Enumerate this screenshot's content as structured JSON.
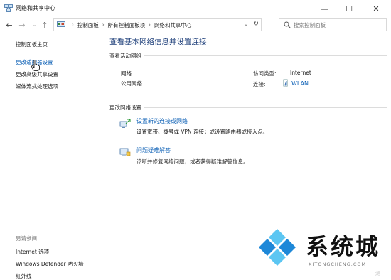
{
  "window": {
    "title": "网络和共享中心",
    "icon": "network-center-icon",
    "controls": {
      "minimize": "—",
      "maximize": "☐",
      "close": "✕"
    }
  },
  "nav": {
    "back": "←",
    "forward": "→",
    "dropdown": "⌄",
    "up": "↑"
  },
  "address": {
    "crumbs": [
      "控制面板",
      "所有控制面板项",
      "网络和共享中心"
    ],
    "separator": "›",
    "dropdown": "⌄",
    "refresh": "↻"
  },
  "search": {
    "placeholder": "搜索控制面板"
  },
  "sidebar": {
    "home": "控制面板主页",
    "items": [
      "更改适配器设置",
      "更改高级共享设置",
      "媒体流式处理选项"
    ],
    "see_also_label": "另请参阅",
    "see_also": [
      "Internet 选项",
      "Windows Defender 防火墙",
      "红外线"
    ]
  },
  "main": {
    "title": "查看基本网络信息并设置连接",
    "active_networks_label": "查看活动网络",
    "network": {
      "name": "网络",
      "type": "公用网络",
      "access_label": "访问类型:",
      "access_value": "Internet",
      "connection_label": "连接:",
      "connection_value": "WLAN"
    },
    "change_settings_label": "更改网络设置",
    "tasks": [
      {
        "title": "设置新的连接或网络",
        "description": "设置宽带、拨号或 VPN 连接；或设置路由器或接入点。",
        "icon": "new-connection-icon"
      },
      {
        "title": "问题疑难解答",
        "description": "诊断并修复网络问题，或者获得疑难解答信息。",
        "icon": "troubleshoot-icon"
      }
    ]
  },
  "watermark": {
    "brand": "系统城",
    "url": "XITONGCHENG.COM",
    "corner": "测",
    "colors": {
      "blue": "#1e88d8",
      "light_blue": "#5cc6f2"
    }
  },
  "colors": {
    "link": "#0b5fb5",
    "title": "#1e3f7a"
  }
}
